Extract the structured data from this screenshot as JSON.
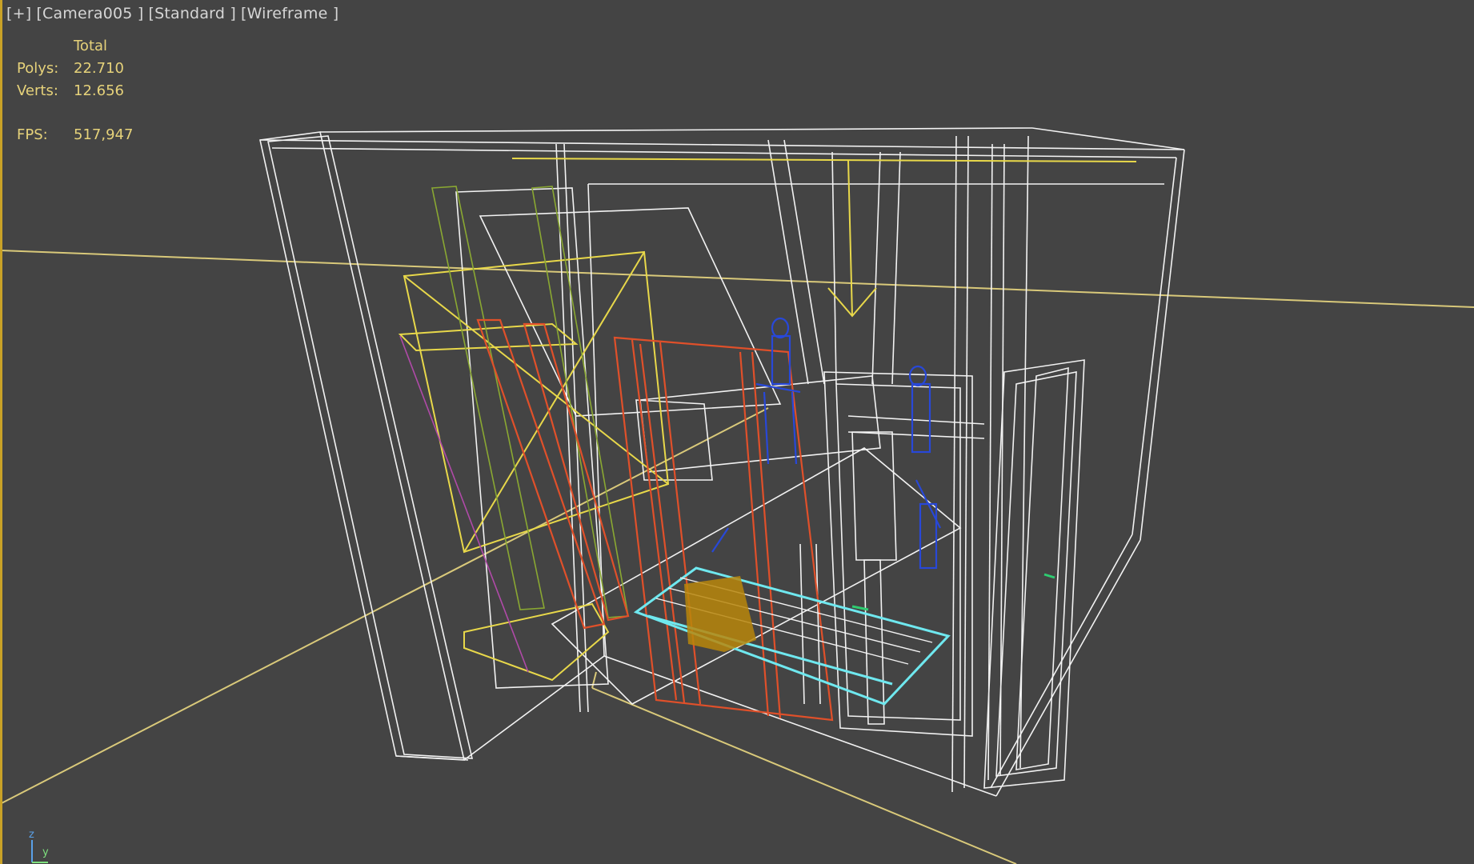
{
  "viewport": {
    "labels": [
      "[+]",
      "[Camera005 ]",
      "[Standard ]",
      "[Wireframe ]"
    ]
  },
  "stats": {
    "total_label": "Total",
    "polys_label": "Polys:",
    "polys_value": "22.710",
    "verts_label": "Verts:",
    "verts_value": "12.656",
    "fps_label": "FPS:",
    "fps_value": "517,947"
  },
  "axis": {
    "z": "z",
    "y": "y"
  },
  "colors": {
    "background": "#444444",
    "wire_white": "#f2f2f2",
    "wire_yellow": "#e8d84a",
    "wire_orange": "#e0502a",
    "wire_blue": "#2848d8",
    "wire_cyan": "#6fe8ef",
    "wire_green": "#8aa832",
    "wire_magenta": "#b04aa8",
    "selected_box": "#b8860b",
    "active_border": "#c9a227"
  }
}
